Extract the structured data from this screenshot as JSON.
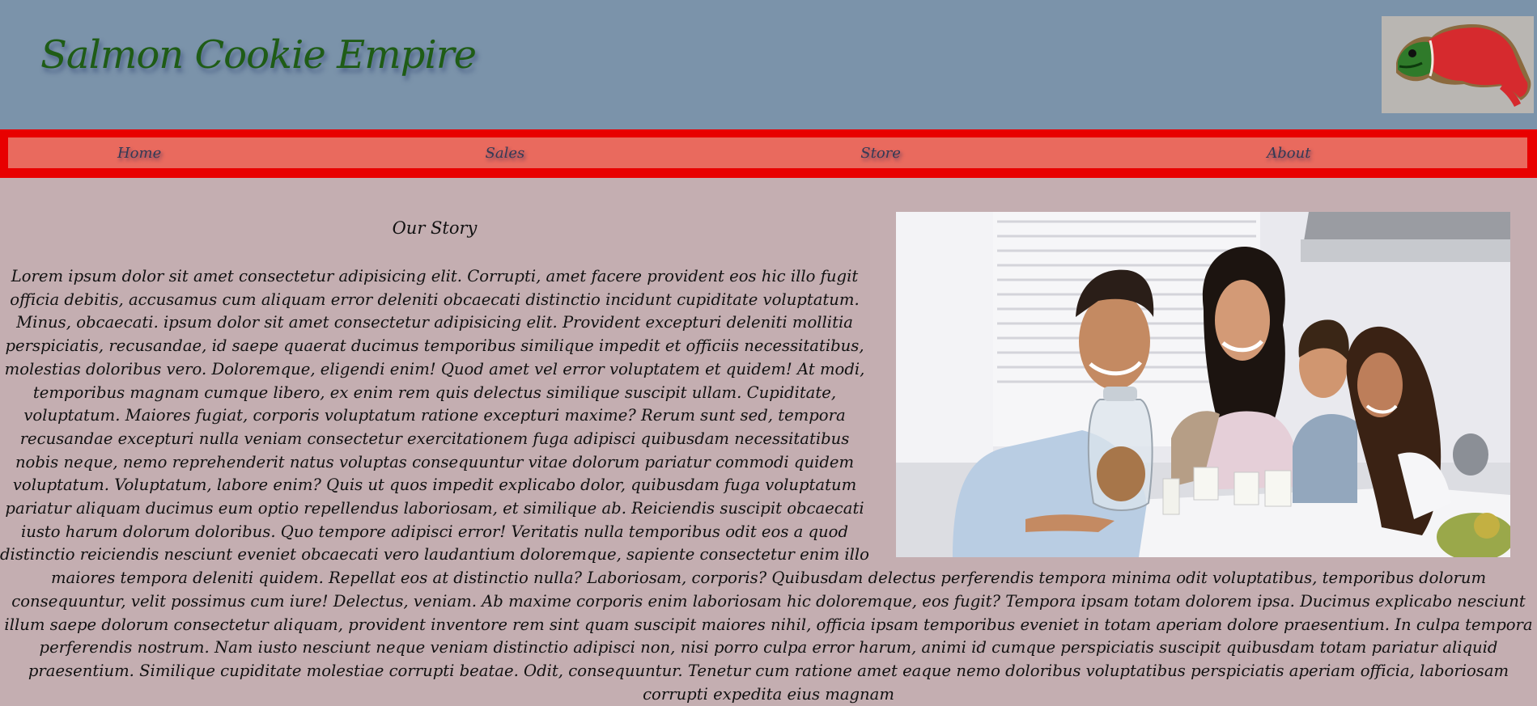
{
  "header": {
    "title": "Salmon Cookie Empire",
    "logo_icon": "salmon-cookie-logo-icon"
  },
  "nav": {
    "items": [
      {
        "label": "Home"
      },
      {
        "label": "Sales"
      },
      {
        "label": "Store"
      },
      {
        "label": "About"
      }
    ]
  },
  "main": {
    "heading": "Our Story",
    "photo_icon": "family-kitchen-photo",
    "paragraph": "Lorem ipsum dolor sit amet consectetur adipisicing elit. Corrupti, amet facere provident eos hic illo fugit officia debitis, accusamus cum aliquam error deleniti obcaecati distinctio incidunt cupiditate voluptatum. Minus, obcaecati. ipsum dolor sit amet consectetur adipisicing elit. Provident excepturi deleniti mollitia perspiciatis, recusandae, id saepe quaerat ducimus temporibus similique impedit et officiis necessitatibus, molestias doloribus vero. Doloremque, eligendi enim! Quod amet vel error voluptatem et quidem! At modi, temporibus magnam cumque libero, ex enim rem quis delectus similique suscipit ullam. Cupiditate, voluptatum. Maiores fugiat, corporis voluptatum ratione excepturi maxime? Rerum sunt sed, tempora recusandae excepturi nulla veniam consectetur exercitationem fuga adipisci quibusdam necessitatibus nobis neque, nemo reprehenderit natus voluptas consequuntur vitae dolorum pariatur commodi quidem voluptatum. Voluptatum, labore enim? Quis ut quos impedit explicabo dolor, quibusdam fuga voluptatum pariatur aliquam ducimus eum optio repellendus laboriosam, et similique ab. Reiciendis suscipit obcaecati iusto harum dolorum doloribus. Quo tempore adipisci error! Veritatis nulla temporibus odit eos a quod distinctio reiciendis nesciunt eveniet obcaecati vero laudantium doloremque, sapiente consectetur enim illo maiores tempora deleniti quidem. Repellat eos at distinctio nulla? Laboriosam, corporis? Quibusdam delectus perferendis tempora minima odit voluptatibus, temporibus dolorum consequuntur, velit possimus cum iure! Delectus, veniam. Ab maxime corporis enim laboriosam hic doloremque, eos fugit? Tempora ipsam totam dolorem ipsa. Ducimus explicabo nesciunt illum saepe dolorum consectetur aliquam, provident inventore rem sint quam suscipit maiores nihil, officia ipsam temporibus eveniet in totam aperiam dolore praesentium. In culpa tempora perferendis nostrum. Nam iusto nesciunt neque veniam distinctio adipisci non, nisi porro culpa error harum, animi id cumque perspiciatis suscipit quibusdam totam pariatur aliquid praesentium. Similique cupiditate molestiae corrupti beatae. Odit, consequuntur. Tenetur cum ratione amet eaque nemo doloribus voluptatibus perspiciatis aperiam officia, laboriosam corrupti expedita eius magnam"
  },
  "colors": {
    "header_bg": "#7b93aa",
    "nav_border": "#e80000",
    "nav_bg": "#e96a5e",
    "page_bg": "#c4aeb1",
    "title_color": "#1f5c16"
  }
}
